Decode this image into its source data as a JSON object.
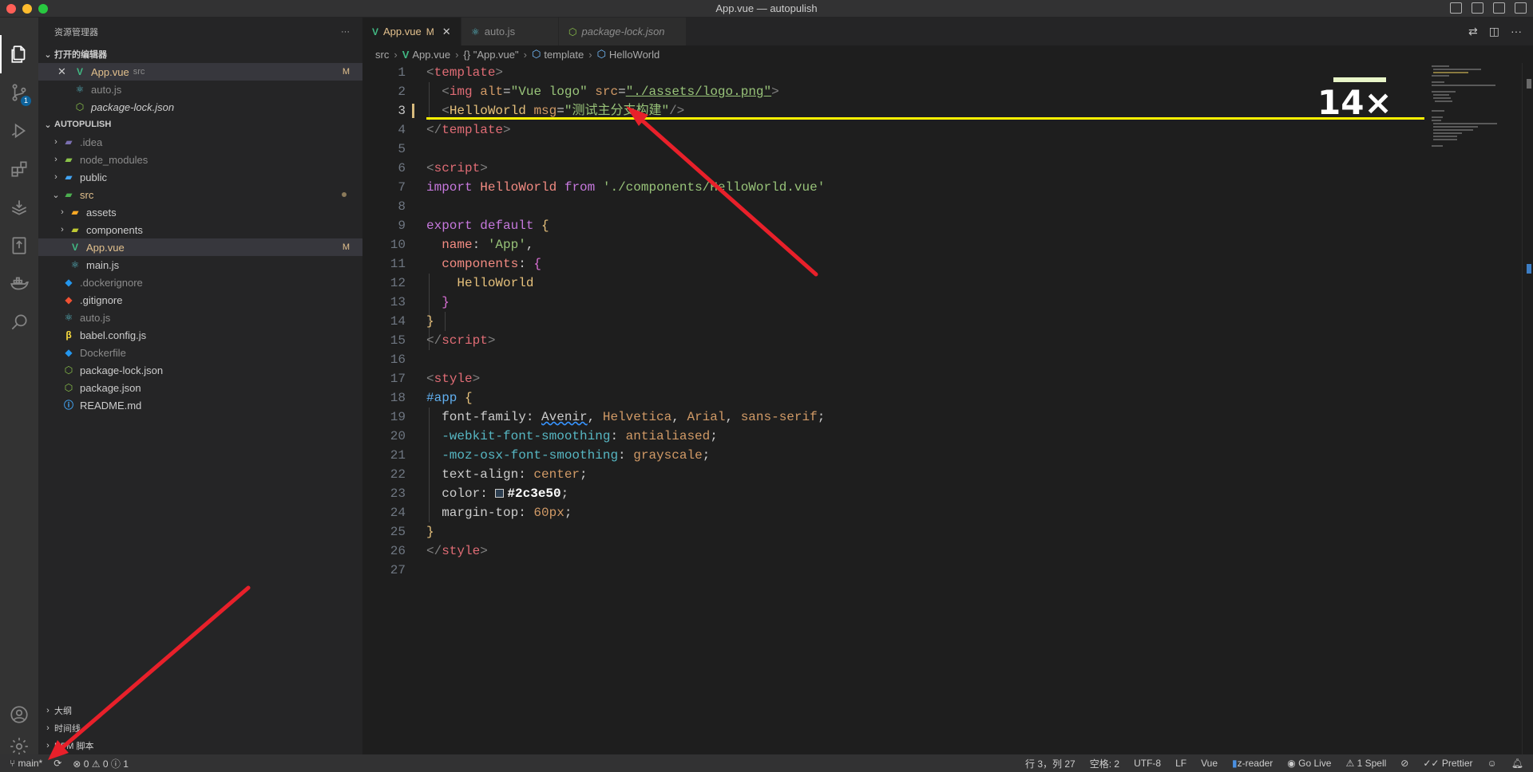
{
  "window": {
    "title": "App.vue — autopulish"
  },
  "activity_bar": {
    "items": [
      "explorer-icon",
      "source-control-icon",
      "run-debug-icon",
      "extensions-icon",
      "deploy-icon",
      "remote-icon",
      "docker-icon",
      "search-icon"
    ],
    "scm_badge": "1"
  },
  "sidebar": {
    "title": "资源管理器",
    "more": "···",
    "open_editors_label": "打开的编辑器",
    "open_editors": [
      {
        "name": "App.vue",
        "tag": "src",
        "badge": "M"
      },
      {
        "name": "auto.js"
      },
      {
        "name": "package-lock.json"
      }
    ],
    "project_label": "AUTOPULISH",
    "tree": [
      {
        "name": ".idea"
      },
      {
        "name": "node_modules"
      },
      {
        "name": "public"
      },
      {
        "name": "src"
      },
      {
        "name": "assets"
      },
      {
        "name": "components"
      },
      {
        "name": "App.vue",
        "badge": "M"
      },
      {
        "name": "main.js"
      },
      {
        "name": ".dockerignore"
      },
      {
        "name": ".gitignore"
      },
      {
        "name": "auto.js"
      },
      {
        "name": "babel.config.js"
      },
      {
        "name": "Dockerfile"
      },
      {
        "name": "package-lock.json"
      },
      {
        "name": "package.json"
      },
      {
        "name": "README.md"
      }
    ],
    "bottom_sections": [
      "大纲",
      "时间线",
      "NPM 脚本"
    ]
  },
  "tabs": [
    {
      "label": "App.vue",
      "badge": "M"
    },
    {
      "label": "auto.js"
    },
    {
      "label": "package-lock.json"
    }
  ],
  "breadcrumb": [
    "src",
    "App.vue",
    "{} \"App.vue\"",
    "template",
    "HelloWorld"
  ],
  "editor": {
    "line_numbers": [
      "1",
      "2",
      "3",
      "4",
      "5",
      "6",
      "7",
      "8",
      "9",
      "10",
      "11",
      "12",
      "13",
      "14",
      "15",
      "16",
      "17",
      "18",
      "19",
      "20",
      "21",
      "22",
      "23",
      "24",
      "25",
      "26",
      "27"
    ],
    "line1": {
      "open": "<",
      "tag": "template",
      "close": ">"
    },
    "line2": {
      "img": "img",
      "alt_attr": "alt",
      "alt_val": "\"Vue logo\"",
      "src_attr": "src",
      "src_val": "\"./assets/logo.png\""
    },
    "line3": {
      "comp": "HelloWorld",
      "msg_attr": "msg",
      "msg_val": "\"测试主分支构建\"",
      "end": "/>"
    },
    "line4": {
      "tag": "template"
    },
    "line6": {
      "tag": "script"
    },
    "line7": {
      "import": "import",
      "name": "HelloWorld",
      "from": "from",
      "path": "'./components/HelloWorld.vue'"
    },
    "line9": {
      "export": "export",
      "default": "default",
      "brace": "{"
    },
    "line10": {
      "key": "name",
      "val": "'App'"
    },
    "line11": {
      "key": "components",
      "brace": "{"
    },
    "line12": {
      "val": "HelloWorld"
    },
    "line13": {
      "brace": "}"
    },
    "line14": {
      "brace": "}"
    },
    "line15": {
      "tag": "script"
    },
    "line17": {
      "tag": "style"
    },
    "line18": {
      "sel": "#app",
      "brace": "{"
    },
    "line19": {
      "prop": "font-family",
      "v1": "Avenir",
      "v2": "Helvetica",
      "v3": "Arial",
      "v4": "sans-serif"
    },
    "line20": {
      "prop": "-webkit-font-smoothing",
      "val": "antialiased"
    },
    "line21": {
      "prop": "-moz-osx-font-smoothing",
      "val": "grayscale"
    },
    "line22": {
      "prop": "text-align",
      "val": "center"
    },
    "line23": {
      "prop": "color",
      "val": "#2c3e50"
    },
    "line24": {
      "prop": "margin-top",
      "val": "60px"
    },
    "line25": {
      "brace": "}"
    },
    "line26": {
      "tag": "style"
    },
    "zoom_label": "14×"
  },
  "status_bar": {
    "branch": "main*",
    "errors": "0",
    "warnings": "0",
    "info": "1",
    "position": "行 3，列 27",
    "spaces": "空格: 2",
    "encoding": "UTF-8",
    "eol": "LF",
    "language": "Vue",
    "reader": "z-reader",
    "golive": "Go Live",
    "spell": "1 Spell",
    "prettier": "Prettier"
  },
  "colors": {
    "accent_yellow": "#fff200",
    "modified": "#e2c08d",
    "arrow": "#e8202a"
  }
}
